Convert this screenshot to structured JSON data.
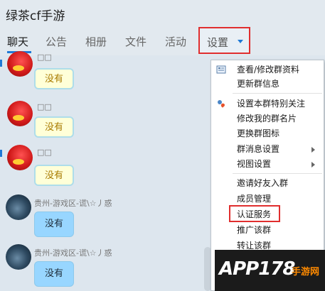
{
  "window": {
    "title": "绿茶cf手游"
  },
  "tabs": [
    {
      "label": "聊天"
    },
    {
      "label": "公告"
    },
    {
      "label": "相册"
    },
    {
      "label": "文件"
    },
    {
      "label": "活动"
    }
  ],
  "settings_tab": {
    "label": "设置"
  },
  "chat": {
    "messages": [
      {
        "sender": "",
        "text": "没有"
      },
      {
        "sender": "□□",
        "text": "没有"
      },
      {
        "sender": "□□",
        "text": "没有"
      },
      {
        "sender": "贵州-游戏区-谎\\☆丿惑",
        "text": "没有"
      },
      {
        "sender": "贵州-游戏区-谎\\☆丿惑",
        "text": "没有"
      }
    ],
    "top_partial_sender": "□□"
  },
  "menu": {
    "items": [
      {
        "label": "查看/修改群资料",
        "icon": "group-info-icon"
      },
      {
        "label": "更新群信息"
      },
      {
        "label": "设置本群特别关注",
        "icon": "follow-heart-icon"
      },
      {
        "label": "修改我的群名片"
      },
      {
        "label": "更换群图标"
      },
      {
        "label": "群消息设置",
        "submenu": true
      },
      {
        "label": "视图设置",
        "submenu": true
      },
      {
        "label": "邀请好友入群"
      },
      {
        "label": "成员管理"
      },
      {
        "label": "认证服务"
      },
      {
        "label": "推广该群"
      },
      {
        "label": "转让该群"
      }
    ]
  },
  "watermark": {
    "main": "APP178",
    "sub": "手游网"
  },
  "colors": {
    "accent": "#1f79d6",
    "highlight": "#e02e2e"
  }
}
